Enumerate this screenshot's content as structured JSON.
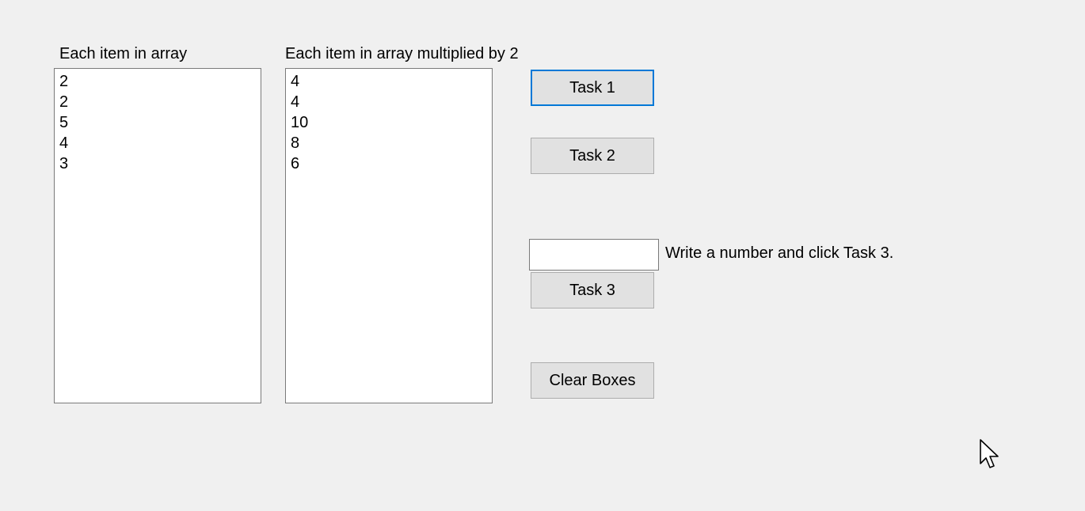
{
  "form": {
    "list1": {
      "label": "Each item in array",
      "items": [
        "2",
        "2",
        "5",
        "4",
        "3"
      ]
    },
    "list2": {
      "label": "Each item in array multiplied by 2",
      "items": [
        "4",
        "4",
        "10",
        "8",
        "6"
      ]
    },
    "buttons": {
      "task1": "Task 1",
      "task2": "Task 2",
      "task3": "Task 3",
      "clear": "Clear Boxes"
    },
    "input": {
      "value": "",
      "hint": "Write a number and click Task 3."
    }
  },
  "colors": {
    "background": "#f0f0f0",
    "focus_border": "#0078d7",
    "button_face": "#e1e1e1"
  }
}
